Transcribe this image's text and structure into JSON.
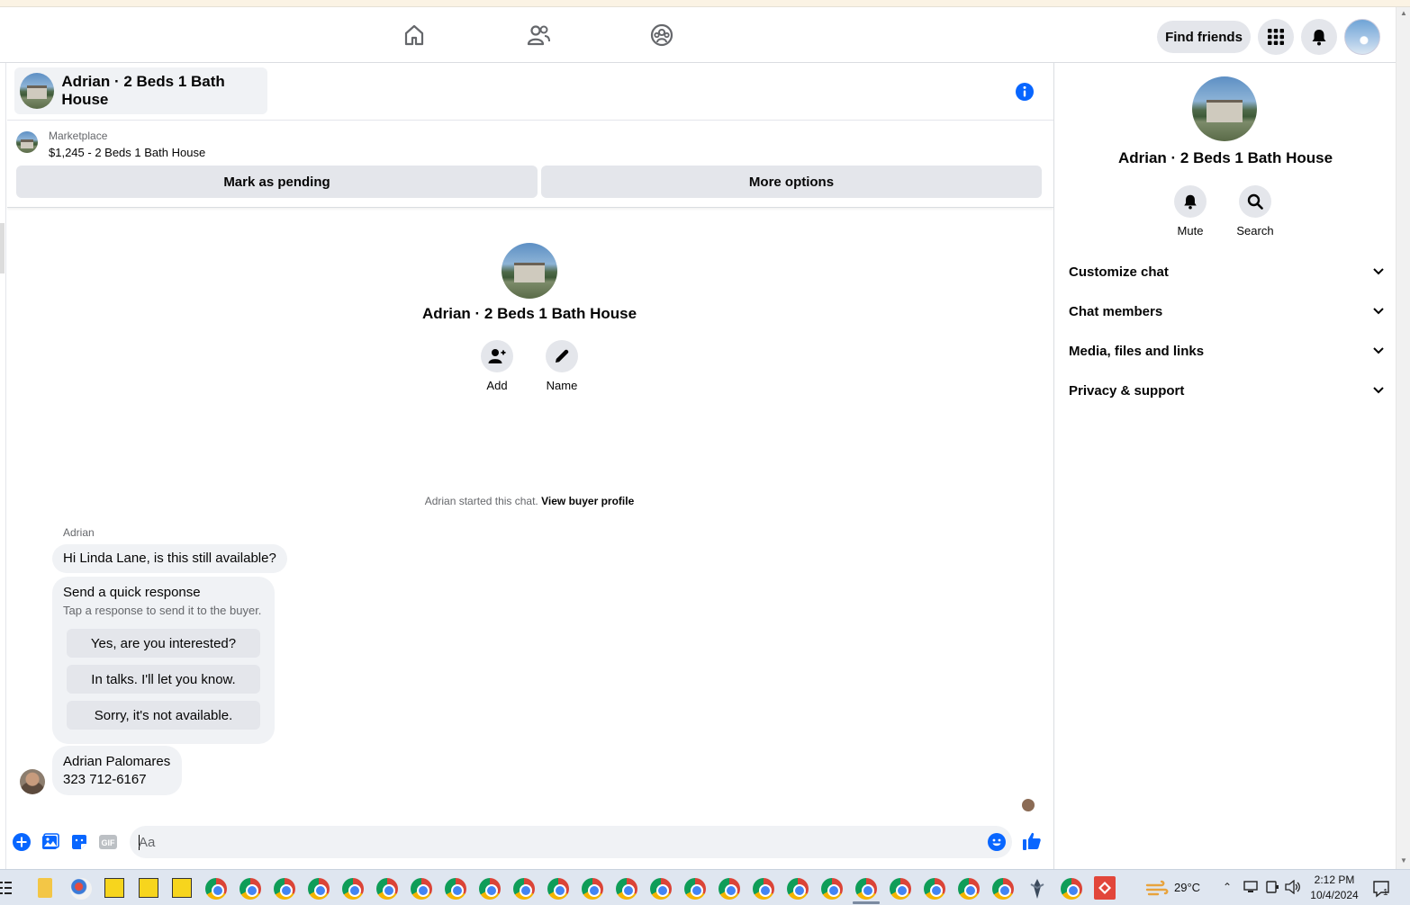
{
  "topbar": {
    "nav": [
      {
        "name": "home-icon"
      },
      {
        "name": "friends-icon"
      },
      {
        "name": "groups-icon"
      }
    ],
    "find_friends_label": "Find friends",
    "menu_icon": "grid-menu-icon",
    "notifications_icon": "bell-icon"
  },
  "chat": {
    "title": "Adrian · 2 Beds 1 Bath House",
    "info_icon": "info-icon"
  },
  "marketplace": {
    "label": "Marketplace",
    "listing": "$1,245 - 2 Beds 1 Bath House",
    "mark_pending_label": "Mark as pending",
    "more_options_label": "More options"
  },
  "profile_center": {
    "name": "Adrian · 2 Beds 1 Bath House",
    "add_label": "Add",
    "name_label": "Name"
  },
  "started": {
    "text": "Adrian started this chat.",
    "link": "View buyer profile"
  },
  "messages": {
    "sender": "Adrian",
    "first": "Hi Linda Lane, is this still available?",
    "quick_title": "Send a quick response",
    "quick_subtitle": "Tap a response to send it to the buyer.",
    "quick_responses": [
      "Yes, are you interested?",
      "In talks. I'll let you know.",
      "Sorry, it's not available."
    ],
    "contact_name": "Adrian Palomares",
    "contact_phone": "323 712-6167"
  },
  "composer": {
    "placeholder": "Aa"
  },
  "right_panel": {
    "name": "Adrian · 2 Beds 1 Bath House",
    "mute_label": "Mute",
    "search_label": "Search",
    "sections": [
      "Customize chat",
      "Chat members",
      "Media, files and links",
      "Privacy & support"
    ]
  },
  "taskbar": {
    "temperature": "29°C",
    "time": "2:12 PM",
    "date": "10/4/2024",
    "notification_count": "1"
  },
  "colors": {
    "accent": "#0866ff",
    "bubble_bg": "#f0f2f5",
    "button_bg": "#e4e6eb"
  }
}
